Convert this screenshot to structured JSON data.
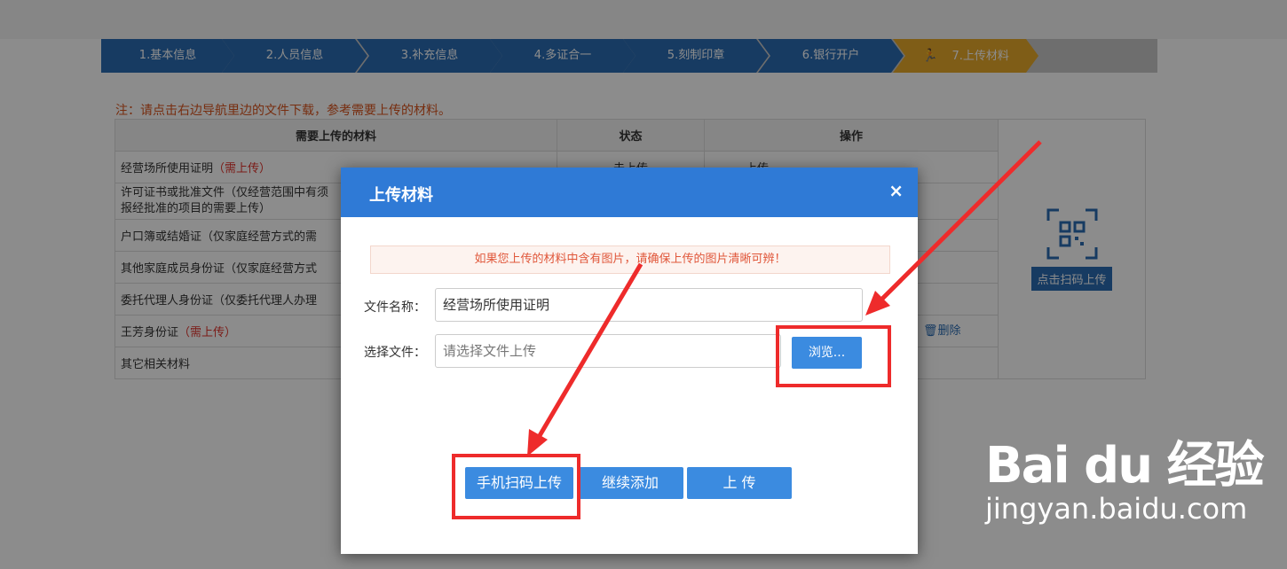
{
  "steps": [
    {
      "label": "1.基本信息"
    },
    {
      "label": "2.人员信息"
    },
    {
      "label": "3.补充信息"
    },
    {
      "label": "4.多证合一"
    },
    {
      "label": "5.刻制印章"
    },
    {
      "label": "6.银行开户"
    },
    {
      "label": "7.上传材料",
      "active": true
    }
  ],
  "note": "注：请点击右边导航里边的文件下载，参考需要上传的材料。",
  "table": {
    "headers": [
      "需要上传的材料",
      "状态",
      "操作"
    ],
    "rows": [
      {
        "name": "经营场所使用证明",
        "tag": "（需上传）",
        "status": "未上传",
        "op": "上传"
      },
      {
        "name": "许可证书或批准文件（仅经营范围中有须",
        "name2": "报经批准的项目的需要上传）",
        "tag": ""
      },
      {
        "name": "户口簿或结婚证（仅家庭经营方式的需",
        "tag": ""
      },
      {
        "name": "其他家庭成员身份证（仅家庭经营方式",
        "tag": ""
      },
      {
        "name": "委托代理人身份证（仅委托代理人办理",
        "tag": ""
      },
      {
        "name": "王芳身份证",
        "tag": "（需上传）"
      },
      {
        "name": "其它相关材料",
        "tag": ""
      }
    ],
    "qr_button": "点击扫码上传",
    "delete_label": "删除"
  },
  "modal": {
    "title": "上传材料",
    "close": "×",
    "tip": "如果您上传的材料中含有图片，请确保上传的图片清晰可辨！",
    "file_name_label": "文件名称：",
    "file_name_value": "经营场所使用证明",
    "choose_file_label": "选择文件：",
    "choose_file_placeholder": "请选择文件上传",
    "browse_label": "浏览...",
    "scan_upload_label": "手机扫码上传",
    "continue_add_label": "继续添加",
    "upload_label": "上  传"
  },
  "watermark": {
    "brand": "Bai du 经验",
    "url": "jingyan.baidu.com"
  },
  "colors": {
    "primary": "#2f7ad6",
    "step_blue": "#2b6cb3",
    "step_active": "#e8a92a",
    "highlight_red": "#ee2b2b"
  }
}
